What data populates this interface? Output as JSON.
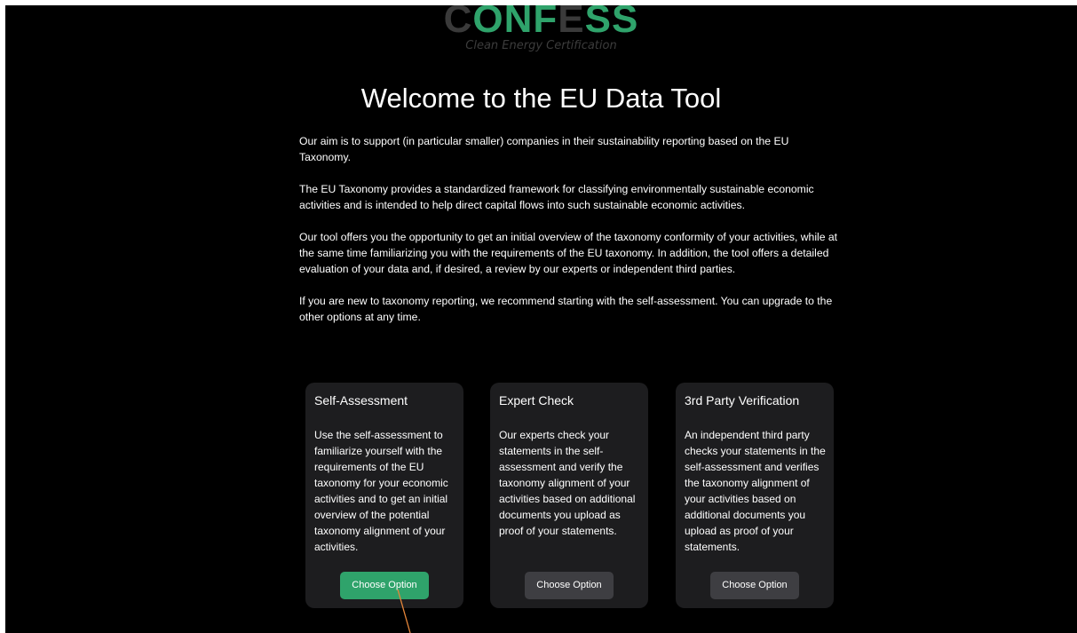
{
  "logo": {
    "part1": "C",
    "part2": "ONF",
    "part3": "E",
    "part4": "SS",
    "tagline": "Clean Energy Certification",
    "colors": {
      "green": "#2fa36b",
      "grey": "#3a3a3a"
    }
  },
  "page": {
    "title": "Welcome to the EU Data Tool",
    "paragraphs": [
      "Our aim is to support (in particular smaller) companies in their sustainability reporting based on the EU Taxonomy.",
      "The EU Taxonomy provides a standardized framework for classifying environmentally sustainable economic activities and is intended to help direct capital flows into such sustainable economic activities.",
      "Our tool offers you the opportunity to get an initial overview of the taxonomy conformity of your activities, while at the same time familiarizing you with the requirements of the EU taxonomy. In addition, the tool offers a detailed evaluation of your data and, if desired, a review by our experts or independent third parties.",
      "If you are new to taxonomy reporting, we recommend starting with the self-assessment. You can upgrade to the other options at any time."
    ]
  },
  "options": [
    {
      "title": "Self-Assessment",
      "description": "Use the self-assessment to familiarize yourself with the requirements of the EU taxonomy for your economic activities and to get an initial overview of the potential taxonomy alignment of your activities.",
      "button_label": "Choose Option",
      "selected": true
    },
    {
      "title": "Expert Check",
      "description": "Our experts check your statements in the self-assessment and verify the taxonomy alignment of your activities based on additional documents you upload as proof of your statements.",
      "button_label": "Choose Option",
      "selected": false
    },
    {
      "title": "3rd Party Verification",
      "description": "An independent third party checks your statements in the self-assessment and verifies the taxonomy alignment of your activities based on additional documents you upload as proof of your statements.",
      "button_label": "Choose Option",
      "selected": false
    }
  ],
  "colors": {
    "background": "#000000",
    "card": "#1d1d1f",
    "accent": "#2fa36b",
    "button": "#3e3e42",
    "pointer": "#e8873a"
  }
}
